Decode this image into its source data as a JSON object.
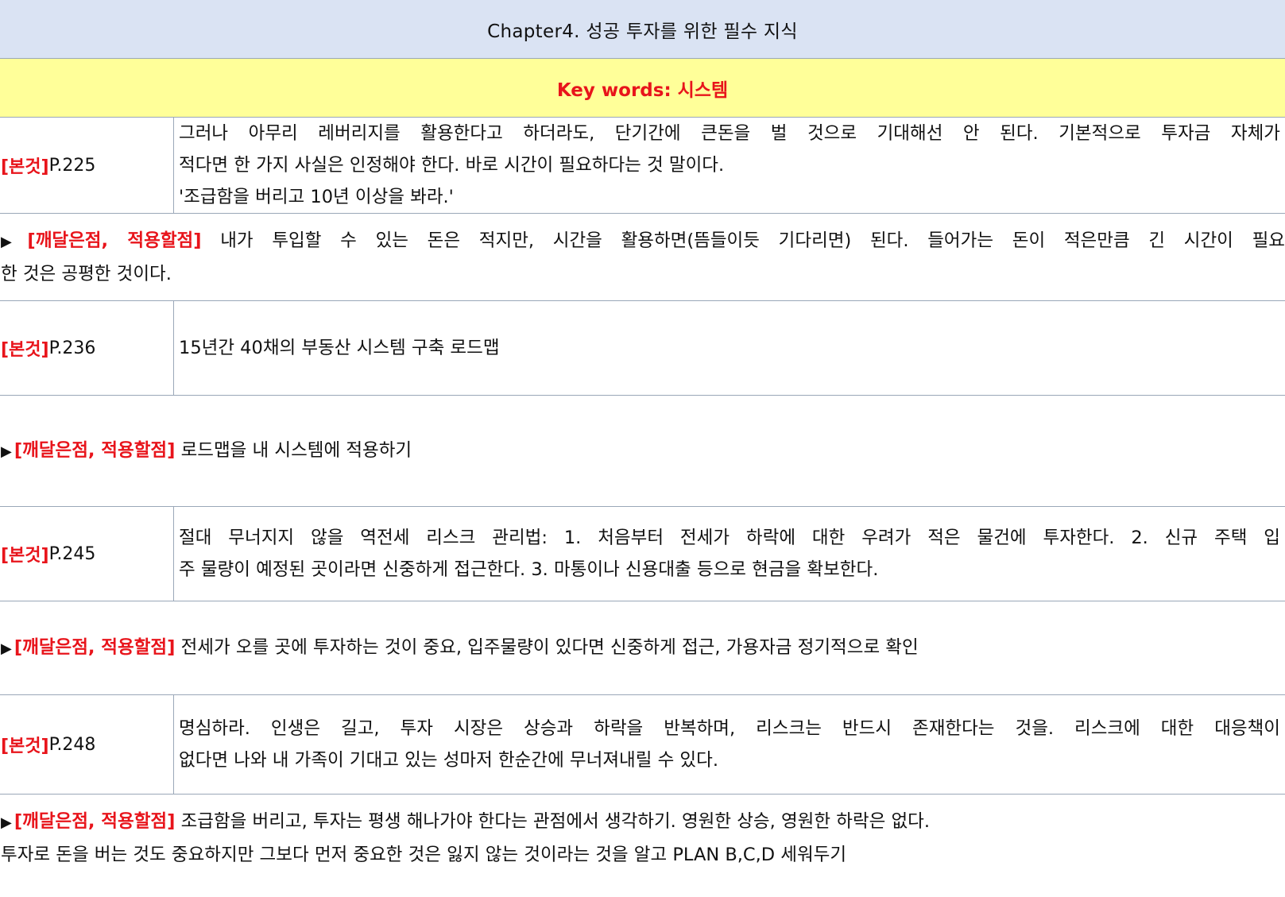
{
  "chapter_title": "Chapter4. 성공 투자를 위한 필수 지식",
  "keywords": "Key words: 시스템",
  "labels": {
    "quote_tag": "[본것]",
    "insight_tag": "[깨달은점, 적용할점]",
    "arrow": "▶"
  },
  "entries": [
    {
      "page": "P.225",
      "quote_lines": [
        "그러나 아무리 레버리지를 활용한다고 하더라도, 단기간에 큰돈을 벌 것으로 기대해선 안 된다. 기본적으로 투자금 자체가",
        "적다면 한 가지 사실은 인정해야 한다. 바로 시간이 필요하다는 것 말이다.",
        "'조급함을 버리고 10년 이상을 봐라.'"
      ],
      "insight_lines": [
        "내가 투입할 수 있는 돈은 적지만, 시간을 활용하면(뜸들이듯 기다리면) 된다. 들어가는 돈이 적은만큼 긴 시간이 필요",
        "한 것은 공평한 것이다."
      ]
    },
    {
      "page": "P.236",
      "quote_lines": [
        "15년간 40채의 부동산 시스템 구축 로드맵"
      ],
      "insight_lines": [
        "로드맵을 내 시스템에 적용하기"
      ]
    },
    {
      "page": "P.245",
      "quote_lines": [
        "절대 무너지지 않을 역전세 리스크 관리법: 1. 처음부터 전세가 하락에 대한 우려가 적은 물건에 투자한다. 2. 신규 주택 입",
        "주 물량이 예정된 곳이라면 신중하게 접근한다. 3. 마통이나 신용대출 등으로 현금을 확보한다."
      ],
      "insight_lines": [
        "전세가 오를 곳에 투자하는 것이 중요, 입주물량이 있다면 신중하게 접근, 가용자금 정기적으로 확인"
      ]
    },
    {
      "page": "P.248",
      "quote_lines": [
        "명심하라. 인생은 길고, 투자 시장은 상승과 하락을 반복하며, 리스크는 반드시 존재한다는 것을. 리스크에 대한 대응책이",
        "없다면 나와 내 가족이 기대고 있는 성마저 한순간에 무너져내릴 수 있다."
      ],
      "insight_lines": [
        "조급함을 버리고, 투자는 평생 해나가야 한다는 관점에서 생각하기. 영원한 상승, 영원한 하락은 없다.",
        "투자로 돈을 버는 것도 중요하지만 그보다 먼저 중요한 것은 잃지 않는 것이라는 것을 알고 PLAN B,C,D 세워두기"
      ]
    }
  ]
}
